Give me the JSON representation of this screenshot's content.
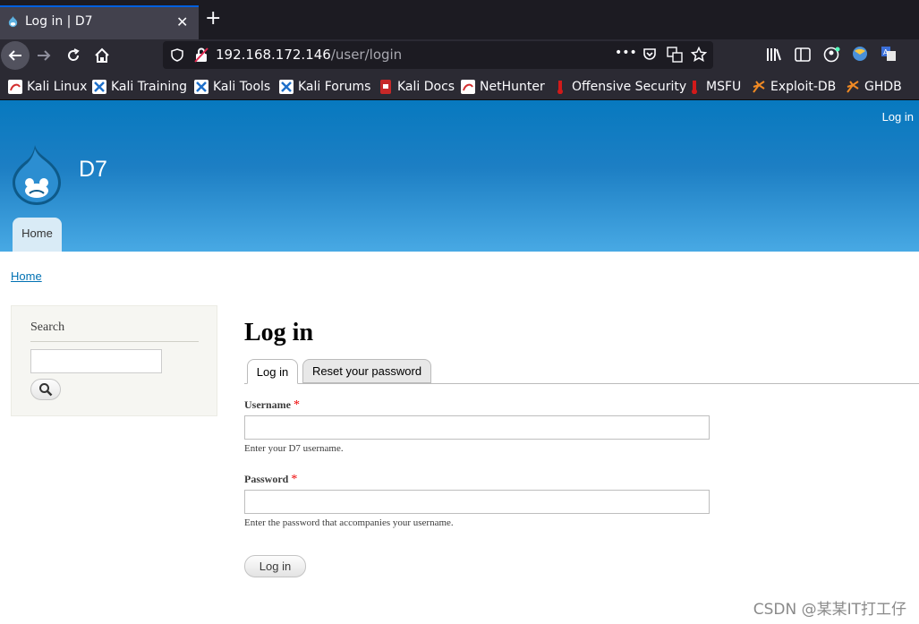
{
  "browser": {
    "tab_title": "Log in | D7",
    "tab_close": "✕",
    "new_tab": "+",
    "url_host": "192.168.172.146",
    "url_path": "/user/login",
    "url_more": "•••",
    "bookmarks": [
      {
        "label": "Kali Linux",
        "icon": "kali-dragon-icon"
      },
      {
        "label": "Kali Training",
        "icon": "kali-training-icon"
      },
      {
        "label": "Kali Tools",
        "icon": "kali-tools-icon"
      },
      {
        "label": "Kali Forums",
        "icon": "kali-forums-icon"
      },
      {
        "label": "Kali Docs",
        "icon": "kali-docs-icon"
      },
      {
        "label": "NetHunter",
        "icon": "nethunter-icon"
      },
      {
        "label": "Offensive Security",
        "icon": "offsec-icon"
      },
      {
        "label": "MSFU",
        "icon": "msfu-icon"
      },
      {
        "label": "Exploit-DB",
        "icon": "exploitdb-icon"
      },
      {
        "label": "GHDB",
        "icon": "ghdb-icon"
      }
    ]
  },
  "site": {
    "header_login": "Log in",
    "name": "D7",
    "primary_tab": "Home",
    "breadcrumb": "Home"
  },
  "sidebar": {
    "search_title": "Search"
  },
  "main": {
    "title": "Log in",
    "tabs": [
      {
        "label": "Log in",
        "active": true
      },
      {
        "label": "Reset your password",
        "active": false
      }
    ],
    "username_label": "Username",
    "username_desc": "Enter your D7 username.",
    "password_label": "Password",
    "password_desc": "Enter the password that accompanies your username.",
    "required_mark": "*",
    "submit_label": "Log in"
  },
  "watermark": "CSDN @某某IT打工仔",
  "colors": {
    "header_top": "#0779bf",
    "header_bottom": "#48a9e4",
    "link": "#0071b3",
    "required": "#e00000"
  }
}
